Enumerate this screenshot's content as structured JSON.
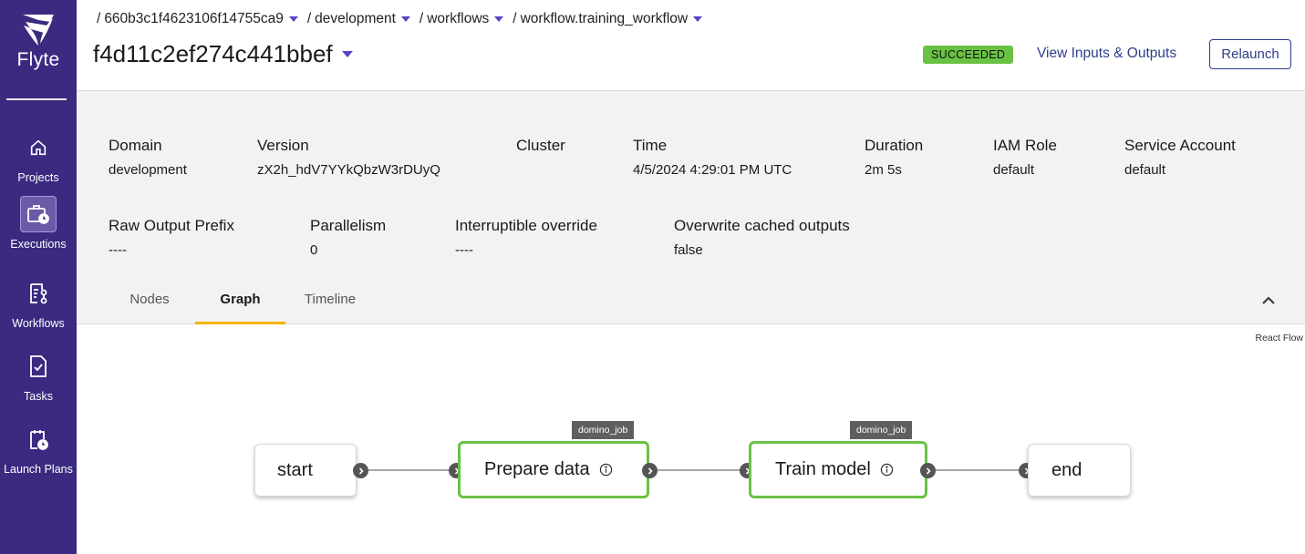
{
  "app": {
    "name": "Flyte",
    "accent_color": "#3b2a80",
    "status_color": "#6ac243"
  },
  "sidebar": {
    "items": [
      {
        "label": "Projects",
        "icon": "home-icon",
        "active": false
      },
      {
        "label": "Executions",
        "icon": "executions-icon",
        "active": true
      },
      {
        "label": "Workflows",
        "icon": "workflows-icon",
        "active": false
      },
      {
        "label": "Tasks",
        "icon": "tasks-icon",
        "active": false
      },
      {
        "label": "Launch Plans",
        "icon": "launch-plans-icon",
        "active": false
      }
    ]
  },
  "breadcrumb": {
    "items": [
      {
        "label": "660b3c1f4623106f14755ca9"
      },
      {
        "label": "development"
      },
      {
        "label": "workflows"
      },
      {
        "label": "workflow.training_workflow"
      }
    ]
  },
  "execution": {
    "id": "f4d11c2ef274c441bbef",
    "status": "SUCCEEDED",
    "view_io_label": "View Inputs & Outputs",
    "relaunch_label": "Relaunch"
  },
  "details": {
    "row1": [
      {
        "label": "Domain",
        "value": "development"
      },
      {
        "label": "Version",
        "value": "zX2h_hdV7YYkQbzW3rDUyQ"
      },
      {
        "label": "Cluster",
        "value": ""
      },
      {
        "label": "Time",
        "value": "4/5/2024 4:29:01 PM UTC"
      },
      {
        "label": "Duration",
        "value": "2m 5s"
      },
      {
        "label": "IAM Role",
        "value": "default"
      },
      {
        "label": "Service Account",
        "value": "default"
      }
    ],
    "row2": [
      {
        "label": "Raw Output Prefix",
        "value": "----"
      },
      {
        "label": "Parallelism",
        "value": "0"
      },
      {
        "label": "Interruptible override",
        "value": "----"
      },
      {
        "label": "Overwrite cached outputs",
        "value": "false"
      }
    ]
  },
  "tabs": [
    {
      "label": "Nodes",
      "active": false
    },
    {
      "label": "Graph",
      "active": true
    },
    {
      "label": "Timeline",
      "active": false
    }
  ],
  "graph": {
    "attribution": "React Flow",
    "nodes": [
      {
        "label": "start",
        "type": "terminal"
      },
      {
        "label": "Prepare data",
        "type": "task",
        "tag": "domino_job"
      },
      {
        "label": "Train model",
        "type": "task",
        "tag": "domino_job"
      },
      {
        "label": "end",
        "type": "terminal"
      }
    ]
  }
}
